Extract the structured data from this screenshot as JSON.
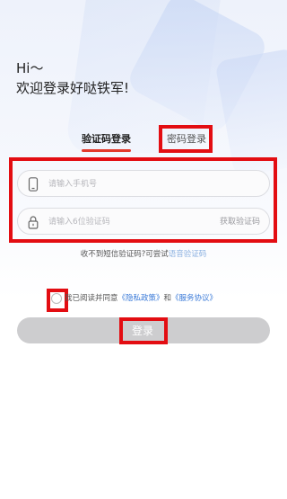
{
  "greeting": "Hi～",
  "welcome": "欢迎登录好哒铁军!",
  "tabs": {
    "sms": "验证码登录",
    "password": "密码登录"
  },
  "phone_field": {
    "placeholder": "请输入手机号"
  },
  "code_field": {
    "placeholder": "请输入6位验证码",
    "action": "获取验证码"
  },
  "voice_hint": {
    "prefix": "收不到短信验证码?可尝试",
    "link": "语音验证码"
  },
  "agreement": {
    "prefix": "我已阅读并同意",
    "privacy": "《隐私政策》",
    "and": "和",
    "service": "《服务协议》",
    "checked": false
  },
  "login_button": {
    "label": "登录",
    "enabled": false
  },
  "colors": {
    "accent": "#e33a2c",
    "link": "#3a7ad8",
    "highlight_box": "#e30d12",
    "button_disabled": "#cdcdcf"
  },
  "icons": {
    "phone": "phone-icon",
    "lock": "lock-icon"
  }
}
